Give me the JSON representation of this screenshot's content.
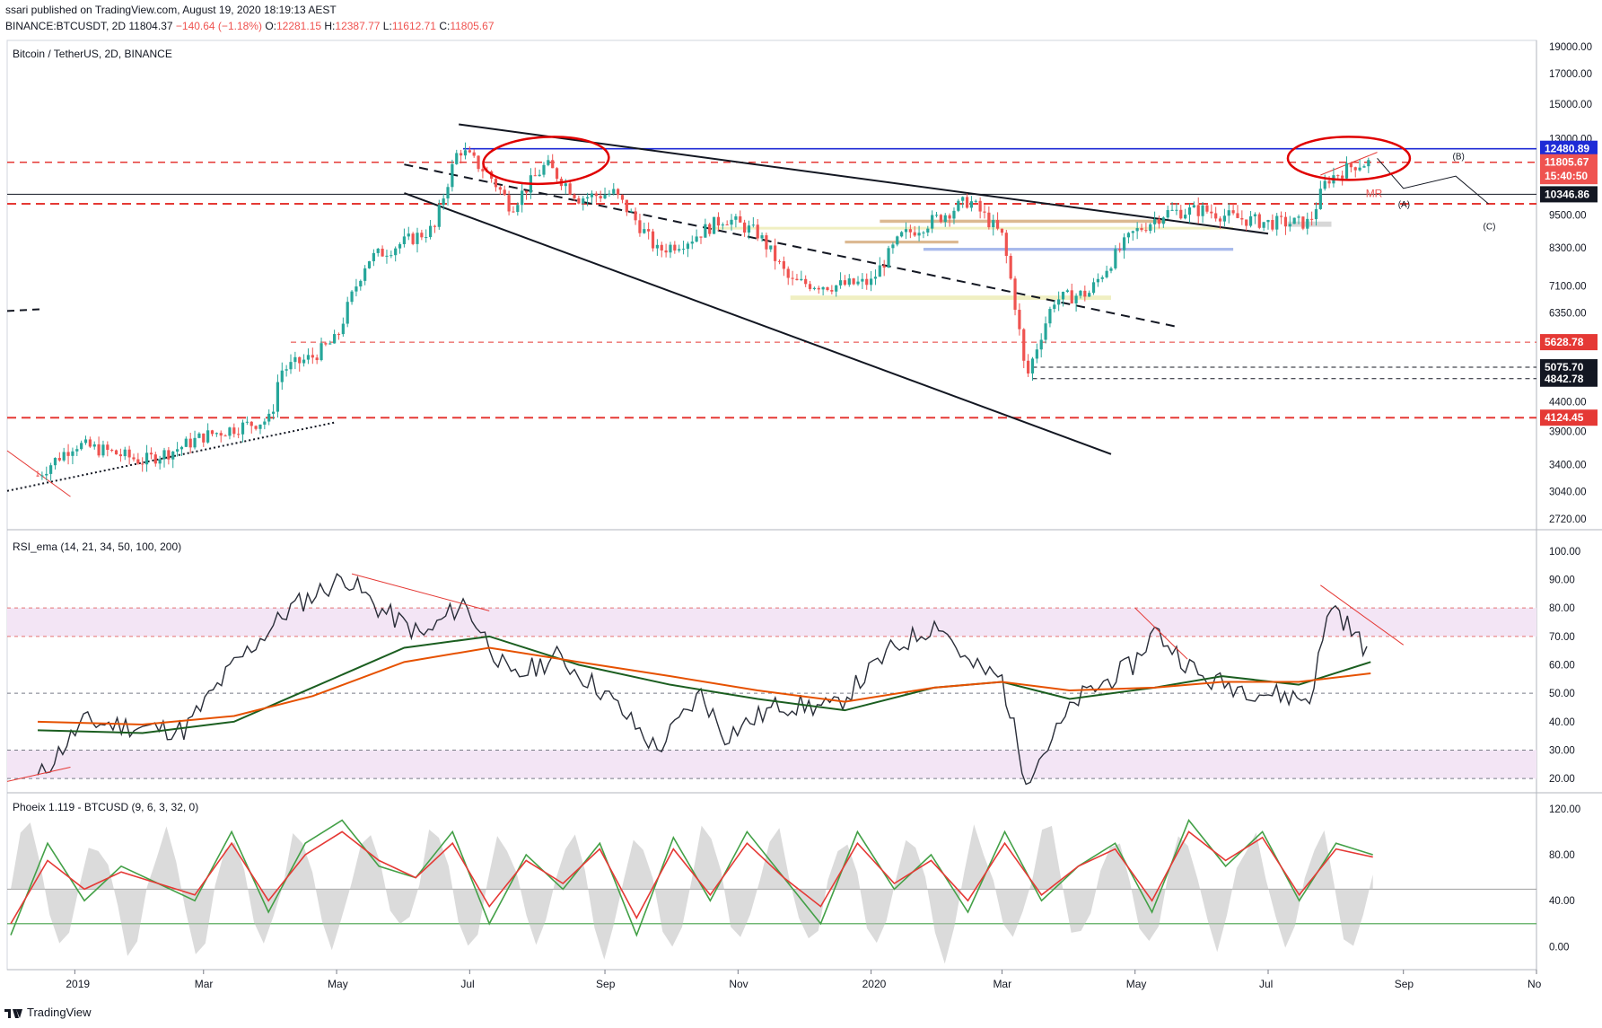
{
  "header": {
    "line1": "ssari published on TradingView.com, August 19, 2020 18:19:13 AEST",
    "symbol": "BINANCE:BTCUSDT, 2D",
    "last": "11804.37",
    "change": "−140.64 (−1.18%)",
    "o_label": "O:",
    "o_value": "12281.15",
    "h_label": "H:",
    "h_value": "12387.77",
    "l_label": "L:",
    "l_value": "11612.71",
    "c_label": "C:",
    "c_value": "11805.67"
  },
  "footer": {
    "brand": "TradingView"
  },
  "colors": {
    "candle_up": "#26a69a",
    "candle_down": "#ef5350",
    "rsi_line": "#2a2e39",
    "ema_fast": "#1b5e20",
    "ema_slow": "#e65100",
    "phoeix_green": "#43a047",
    "phoeix_red": "#e53935",
    "level_red": "#e53935",
    "level_blue": "#1e2bd6",
    "annotation": "#e00000",
    "band_fill": "#f3e5f5"
  },
  "chart_data": [
    {
      "type": "candlestick",
      "title": "Bitcoin / TetherUS, 2D, BINANCE",
      "y_scale": "log",
      "ylim": [
        2600,
        19500
      ],
      "y_ticks": [
        19000,
        17000,
        15000,
        13000,
        9500,
        8300,
        7100,
        6350,
        4400,
        3900,
        3400,
        3040,
        2720
      ],
      "y_tick_labels": [
        "19000.00",
        "17000.00",
        "15000.00",
        "13000.00",
        "9500.00",
        "8300.00",
        "7100.00",
        "6350.00",
        "4400.00",
        "3900.00",
        "3400.00",
        "3040.00",
        "2720.00"
      ],
      "price_labels": [
        {
          "text": "12480.89",
          "value": 12480.89,
          "bg": "#1e2bd6",
          "fg": "#ffffff"
        },
        {
          "text": "11805.67",
          "value": 11805.67,
          "bg": "#ef5350",
          "fg": "#ffffff"
        },
        {
          "text": "15:40:50",
          "value": 11150,
          "bg": "#ef5350",
          "fg": "#ffffff"
        },
        {
          "text": "10346.86",
          "value": 10346.86,
          "bg": "#131722",
          "fg": "#ffffff"
        },
        {
          "text": "5628.78",
          "value": 5628.78,
          "bg": "#e53935",
          "fg": "#ffffff"
        },
        {
          "text": "5075.70",
          "value": 5075.7,
          "bg": "#131722",
          "fg": "#ffffff"
        },
        {
          "text": "4842.78",
          "value": 4842.78,
          "bg": "#131722",
          "fg": "#ffffff"
        },
        {
          "text": "4124.45",
          "value": 4124.45,
          "bg": "#e53935",
          "fg": "#ffffff"
        }
      ],
      "annotations": [
        "MR",
        "(A)",
        "(B)",
        "(C)"
      ],
      "series": [
        {
          "name": "BTCUSDT",
          "points": [
            {
              "date": "2018-12-15",
              "close": 3250
            },
            {
              "date": "2019-01-01",
              "close": 3700
            },
            {
              "date": "2019-01-15",
              "close": 3600
            },
            {
              "date": "2019-02-01",
              "close": 3450
            },
            {
              "date": "2019-02-15",
              "close": 3600
            },
            {
              "date": "2019-03-01",
              "close": 3820
            },
            {
              "date": "2019-03-15",
              "close": 3950
            },
            {
              "date": "2019-04-01",
              "close": 4100
            },
            {
              "date": "2019-04-05",
              "close": 5000
            },
            {
              "date": "2019-04-20",
              "close": 5300
            },
            {
              "date": "2019-05-01",
              "close": 5700
            },
            {
              "date": "2019-05-15",
              "close": 7900
            },
            {
              "date": "2019-06-01",
              "close": 8500
            },
            {
              "date": "2019-06-15",
              "close": 9000
            },
            {
              "date": "2019-06-26",
              "close": 12500
            },
            {
              "date": "2019-07-10",
              "close": 11200
            },
            {
              "date": "2019-07-20",
              "close": 9800
            },
            {
              "date": "2019-08-05",
              "close": 11700
            },
            {
              "date": "2019-08-20",
              "close": 10200
            },
            {
              "date": "2019-09-05",
              "close": 10400
            },
            {
              "date": "2019-09-25",
              "close": 8200
            },
            {
              "date": "2019-10-10",
              "close": 8600
            },
            {
              "date": "2019-10-26",
              "close": 9400
            },
            {
              "date": "2019-11-10",
              "close": 8800
            },
            {
              "date": "2019-11-25",
              "close": 7200
            },
            {
              "date": "2019-12-15",
              "close": 7100
            },
            {
              "date": "2020-01-01",
              "close": 7200
            },
            {
              "date": "2020-01-15",
              "close": 8700
            },
            {
              "date": "2020-02-01",
              "close": 9400
            },
            {
              "date": "2020-02-15",
              "close": 10100
            },
            {
              "date": "2020-03-01",
              "close": 8700
            },
            {
              "date": "2020-03-12",
              "close": 4800
            },
            {
              "date": "2020-03-25",
              "close": 6700
            },
            {
              "date": "2020-04-10",
              "close": 6900
            },
            {
              "date": "2020-04-30",
              "close": 8800
            },
            {
              "date": "2020-05-15",
              "close": 9600
            },
            {
              "date": "2020-06-01",
              "close": 9700
            },
            {
              "date": "2020-06-15",
              "close": 9400
            },
            {
              "date": "2020-07-01",
              "close": 9200
            },
            {
              "date": "2020-07-20",
              "close": 9200
            },
            {
              "date": "2020-07-28",
              "close": 11000
            },
            {
              "date": "2020-08-10",
              "close": 11700
            },
            {
              "date": "2020-08-17",
              "close": 11805
            }
          ]
        }
      ]
    },
    {
      "type": "line",
      "title": "RSI_ema (14, 21, 34, 50, 100, 200)",
      "ylim": [
        15,
        105
      ],
      "y_ticks": [
        100,
        90,
        80,
        70,
        60,
        50,
        40,
        30,
        20
      ],
      "y_tick_labels": [
        "100.00",
        "90.00",
        "80.00",
        "70.00",
        "60.00",
        "50.00",
        "40.00",
        "30.00",
        "20.00"
      ],
      "series": [
        {
          "values_key": "rsi",
          "x": [
            "2018-12-15",
            "2019-01-05",
            "2019-02-01",
            "2019-02-20",
            "2019-03-15",
            "2019-04-10",
            "2019-05-05",
            "2019-05-20",
            "2019-06-10",
            "2019-06-28",
            "2019-07-20",
            "2019-08-10",
            "2019-09-01",
            "2019-09-25",
            "2019-10-15",
            "2019-10-26",
            "2019-11-20",
            "2019-12-15",
            "2020-01-10",
            "2020-02-01",
            "2020-02-15",
            "2020-03-01",
            "2020-03-12",
            "2020-04-05",
            "2020-04-30",
            "2020-05-10",
            "2020-06-01",
            "2020-07-01",
            "2020-07-20",
            "2020-07-30",
            "2020-08-10",
            "2020-08-17"
          ],
          "values": [
            20,
            40,
            38,
            37,
            60,
            80,
            91,
            80,
            70,
            82,
            55,
            63,
            50,
            30,
            50,
            35,
            46,
            45,
            65,
            75,
            60,
            55,
            20,
            48,
            60,
            72,
            55,
            50,
            48,
            82,
            70,
            64
          ]
        },
        {
          "values_key": "ema_fast",
          "x": [
            "2018-12-15",
            "2019-02-01",
            "2019-03-15",
            "2019-04-20",
            "2019-06-01",
            "2019-07-10",
            "2019-08-20",
            "2019-10-01",
            "2019-11-10",
            "2019-12-20",
            "2020-01-30",
            "2020-03-01",
            "2020-04-01",
            "2020-05-10",
            "2020-06-10",
            "2020-07-15",
            "2020-08-17"
          ],
          "values": [
            37,
            36,
            40,
            52,
            66,
            70,
            60,
            53,
            48,
            44,
            52,
            54,
            48,
            52,
            56,
            53,
            61
          ]
        },
        {
          "values_key": "ema_slow",
          "x": [
            "2018-12-15",
            "2019-02-01",
            "2019-03-15",
            "2019-04-20",
            "2019-06-01",
            "2019-07-10",
            "2019-08-20",
            "2019-10-01",
            "2019-11-10",
            "2019-12-20",
            "2020-01-30",
            "2020-03-01",
            "2020-04-01",
            "2020-05-10",
            "2020-06-10",
            "2020-07-15",
            "2020-08-17"
          ],
          "values": [
            40,
            39,
            42,
            49,
            61,
            66,
            61,
            56,
            51,
            47,
            52,
            54,
            51,
            52,
            54,
            54,
            57
          ]
        }
      ]
    },
    {
      "type": "line",
      "title": "Phoeix 1.119 - BTCUSD (9, 6, 3, 32, 0)",
      "ylim": [
        -20,
        130
      ],
      "y_ticks": [
        120,
        80,
        40,
        0
      ],
      "y_tick_labels": [
        "120.00",
        "80.00",
        "40.00",
        "0.00"
      ],
      "series": [
        {
          "values_key": "green",
          "values": [
            10,
            90,
            40,
            70,
            55,
            40,
            100,
            30,
            90,
            110,
            70,
            60,
            100,
            20,
            80,
            50,
            90,
            10,
            95,
            40,
            100,
            60,
            20,
            100,
            50,
            80,
            30,
            100,
            40,
            70,
            90,
            30,
            110,
            70,
            100,
            40,
            90,
            80
          ]
        },
        {
          "values_key": "red",
          "values": [
            20,
            75,
            50,
            65,
            55,
            45,
            90,
            40,
            80,
            100,
            75,
            60,
            90,
            35,
            75,
            55,
            85,
            25,
            85,
            45,
            90,
            60,
            35,
            90,
            55,
            75,
            40,
            90,
            45,
            70,
            85,
            40,
            100,
            75,
            95,
            45,
            85,
            78
          ]
        }
      ]
    }
  ],
  "x_axis_labels": [
    "2019",
    "Mar",
    "May",
    "Jul",
    "Sep",
    "Nov",
    "2020",
    "Mar",
    "May",
    "Jul",
    "Sep",
    "No"
  ]
}
